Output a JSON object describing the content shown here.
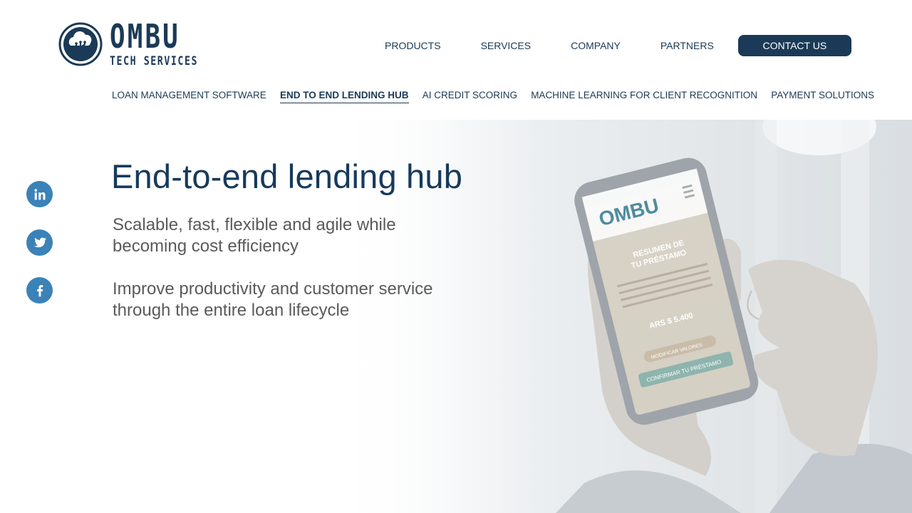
{
  "brand": {
    "name": "OMBU",
    "tagline": "TECH SERVICES"
  },
  "main_nav": {
    "items": [
      {
        "label": "PRODUCTS"
      },
      {
        "label": "SERVICES"
      },
      {
        "label": "COMPANY"
      },
      {
        "label": "PARTNERS"
      }
    ],
    "cta_label": "CONTACT US"
  },
  "sub_nav": {
    "items": [
      {
        "label": "LOAN MANAGEMENT SOFTWARE",
        "active": false
      },
      {
        "label": "END TO END LENDING HUB",
        "active": true
      },
      {
        "label": "AI CREDIT SCORING",
        "active": false
      },
      {
        "label": "MACHINE LEARNING FOR CLIENT RECOGNITION",
        "active": false
      },
      {
        "label": "PAYMENT SOLUTIONS",
        "active": false
      }
    ]
  },
  "hero": {
    "title": "End-to-end lending hub",
    "paragraph1_line1": "Scalable, fast, flexible and agile while",
    "paragraph1_line2": "becoming cost efficiency",
    "paragraph2_line1": "Improve productivity and customer service",
    "paragraph2_line2": "through the entire loan lifecycle"
  },
  "phone_screen": {
    "brand": "OMBU",
    "heading_line1": "RESUMEN DE",
    "heading_line2": "TU PRÉSTAMO",
    "amount": "ARS $ 5.400",
    "button1": "MODIFICAR VALORES",
    "button2": "CONFIRMAR TU PRÉSTAMO"
  },
  "social": [
    {
      "icon": "linkedin-icon"
    },
    {
      "icon": "twitter-icon"
    },
    {
      "icon": "facebook-icon"
    }
  ],
  "colors": {
    "primary": "#1b3a57",
    "social": "#3b82b8",
    "body_text": "#5a5a5a"
  }
}
